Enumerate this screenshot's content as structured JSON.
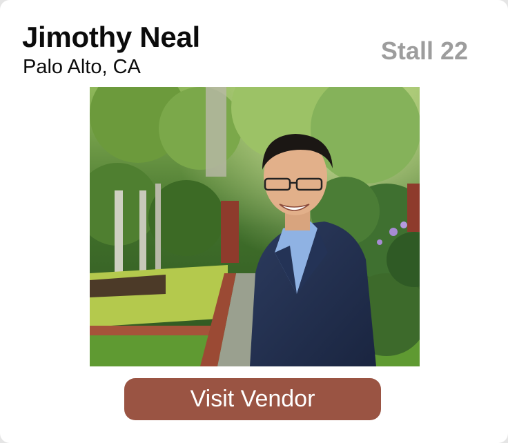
{
  "vendor": {
    "name": "Jimothy Neal",
    "location": "Palo Alto, CA",
    "stall": "Stall 22"
  },
  "actions": {
    "visit_label": "Visit Vendor"
  },
  "colors": {
    "button_bg": "#9a5443",
    "stall_text": "#9d9d9d",
    "card_bg": "#ffffff"
  },
  "photo": {
    "icon": "vendor-portrait-photo"
  }
}
